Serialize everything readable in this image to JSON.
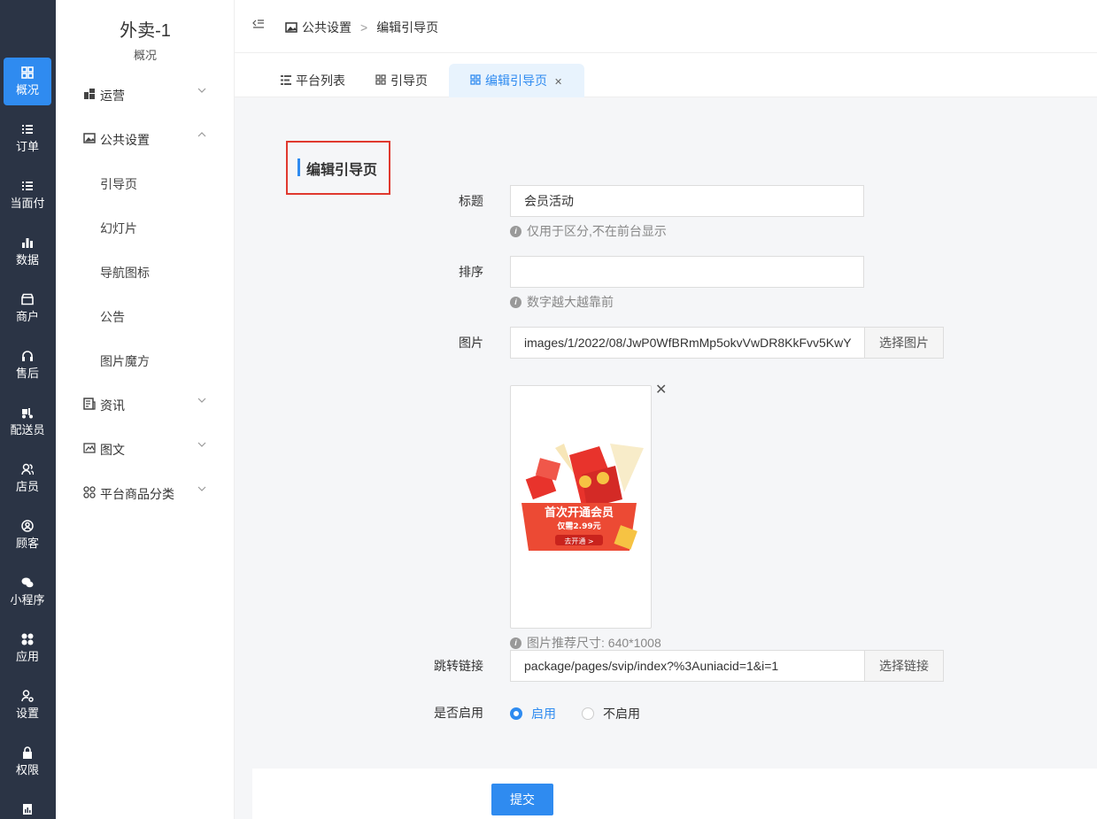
{
  "rail": [
    {
      "icon": "dashboard-icon",
      "label": "概况",
      "active": true
    },
    {
      "icon": "list-icon",
      "label": "订单"
    },
    {
      "icon": "list-icon",
      "label": "当面付"
    },
    {
      "icon": "bar-chart-icon",
      "label": "数据"
    },
    {
      "icon": "store-icon",
      "label": "商户"
    },
    {
      "icon": "headset-icon",
      "label": "售后"
    },
    {
      "icon": "scooter-icon",
      "label": "配送员"
    },
    {
      "icon": "users-icon",
      "label": "店员"
    },
    {
      "icon": "user-circle-icon",
      "label": "顾客"
    },
    {
      "icon": "wechat-icon",
      "label": "小程序"
    },
    {
      "icon": "apps-icon",
      "label": "应用"
    },
    {
      "icon": "user-gear-icon",
      "label": "设置"
    },
    {
      "icon": "lock-icon",
      "label": "权限"
    }
  ],
  "sidebar": {
    "title": "外卖-1",
    "subtitle": "概况",
    "items": [
      {
        "label": "运营",
        "type": "group",
        "chevron": "down"
      },
      {
        "label": "公共设置",
        "type": "group",
        "chevron": "up"
      },
      {
        "label": "引导页",
        "type": "sub"
      },
      {
        "label": "幻灯片",
        "type": "sub"
      },
      {
        "label": "导航图标",
        "type": "sub"
      },
      {
        "label": "公告",
        "type": "sub"
      },
      {
        "label": "图片魔方",
        "type": "sub"
      },
      {
        "label": "资讯",
        "type": "group",
        "chevron": "down"
      },
      {
        "label": "图文",
        "type": "group",
        "chevron": "down"
      },
      {
        "label": "平台商品分类",
        "type": "group",
        "chevron": "down"
      }
    ]
  },
  "breadcrumb": {
    "parent": "公共设置",
    "separator": ">",
    "current": "编辑引导页"
  },
  "tabs": [
    {
      "label": "平台列表"
    },
    {
      "label": "引导页"
    },
    {
      "label": "编辑引导页",
      "active": true
    }
  ],
  "section_title": "编辑引导页",
  "form": {
    "title_label": "标题",
    "title_value": "会员活动",
    "title_help": "仅用于区分,不在前台显示",
    "sort_label": "排序",
    "sort_value": "",
    "sort_help": "数字越大越靠前",
    "image_label": "图片",
    "image_value": "images/1/2022/08/JwP0WfBRmMp5okvVwDR8KkFvv5KwY",
    "image_button": "选择图片",
    "image_help": "图片推荐尺寸: 640*1008",
    "preview_text": {
      "line1": "首次开通会员",
      "line2": "仅需2.99元",
      "line3": "去开通 >"
    },
    "link_label": "跳转链接",
    "link_value": "package/pages/svip/index?%3Auniacid=1&i=1",
    "link_button": "选择链接",
    "enable_label": "是否启用",
    "enable_on": "启用",
    "enable_off": "不启用",
    "enabled": true
  },
  "submit_label": "提交",
  "colors": {
    "primary": "#2f8bf0",
    "rail": "#2b3445",
    "highlight_border": "#e0392f"
  }
}
